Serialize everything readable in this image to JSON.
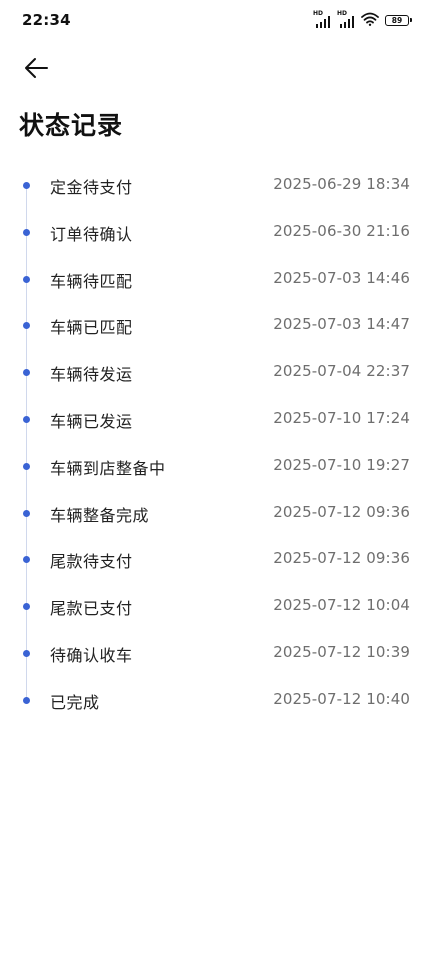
{
  "status_bar": {
    "time": "22:34",
    "signal1_label": "HD",
    "signal2_label": "HD",
    "battery": "89"
  },
  "header": {
    "back_icon": "arrow-left-icon",
    "title": "状态记录"
  },
  "records": [
    {
      "status": "定金待支付",
      "time": "2025-06-29 18:34"
    },
    {
      "status": "订单待确认",
      "time": "2025-06-30 21:16"
    },
    {
      "status": "车辆待匹配",
      "time": "2025-07-03 14:46"
    },
    {
      "status": "车辆已匹配",
      "time": "2025-07-03 14:47"
    },
    {
      "status": "车辆待发运",
      "time": "2025-07-04 22:37"
    },
    {
      "status": "车辆已发运",
      "time": "2025-07-10 17:24"
    },
    {
      "status": "车辆到店整备中",
      "time": "2025-07-10 19:27"
    },
    {
      "status": "车辆整备完成",
      "time": "2025-07-12 09:36"
    },
    {
      "status": "尾款待支付",
      "time": "2025-07-12 09:36"
    },
    {
      "status": "尾款已支付",
      "time": "2025-07-12 10:04"
    },
    {
      "status": "待确认收车",
      "time": "2025-07-12 10:39"
    },
    {
      "status": "已完成",
      "time": "2025-07-12 10:40"
    }
  ],
  "colors": {
    "accent": "#3a63d4",
    "line": "#d0d8ec"
  }
}
